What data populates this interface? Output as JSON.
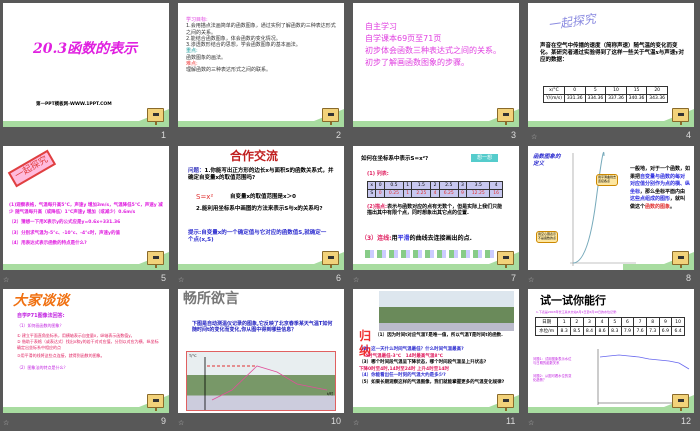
{
  "slides": [
    {
      "num": "1",
      "title": "20.3函数的表示",
      "footer": "第一PPT模板网-WWW.1PPT.COM"
    },
    {
      "num": "2",
      "goal_h": "学习目标:",
      "goals": [
        "1.会用描点法画简单的函数图象，通过实例了解函数的三种表达形式之间的关系。",
        "2.能结合函数图象，体会函数的变化情况。",
        "3.渗透数形结合的思想，学会函数图象的基本画法。"
      ],
      "key_h": "重点:",
      "key": "函数图象的画法。",
      "diff_h": "难点:",
      "diff": "理解函数的三种表达形式之间的联系。"
    },
    {
      "num": "3",
      "items": [
        "自主学习",
        "自学课本69页至71页",
        "初步体会函数三种表达式之间的关系。",
        "初步了解画函数图象的步骤。"
      ]
    },
    {
      "num": "4",
      "title": "一起探究",
      "text": "声音在空气中传播的速度（简称声速）随气温的变化而变化。某研究者通过实验得到了这样一些关于气温x与声速y对应的数据：",
      "table": {
        "row1": [
          "x/°C",
          "0",
          "5",
          "10",
          "15",
          "20"
        ],
        "row2": [
          "Y/(m/s)",
          "331.36",
          "334.36",
          "337.36",
          "340.36",
          "343.36"
        ]
      }
    },
    {
      "num": "5",
      "stamp": "一起探究",
      "q1": "(1)观察表格，气温每升高5°C，声速y 增加3m/s，气温降低5°C，声速y 减少 随气温每升高（或降低）1°C声速y 增加（或减少）0.6m/s",
      "q2": "（2）猜想一下用X表示y的公式应是y=0.6x+331.36",
      "q3": "（3）分别求气温为-5°c、-10°c、-4°c时，声速y的值",
      "q4": "（4）用表达式表示函数的特点是什么?"
    },
    {
      "num": "6",
      "title": "合作交流",
      "q_label": "问题：",
      "q1": "1.你能写出正方形的边长x与面积S的函数关系式，并确定自变量x的取值范围吗?",
      "formula": "S=x²",
      "range": "自变量x的取值范围是x＞0",
      "q2": "2.能利用坐标系中画图的方法来表示S与x的关系吗?",
      "hint": "提示:自变量x的一个确定值与它对应的函数值S,就确定一个点(x,S)"
    },
    {
      "num": "7",
      "question": "如何在坐标系中表示S=x²?",
      "badge": "想一想",
      "step1": "(1) 列表:",
      "x": [
        "x",
        "0",
        "0.5",
        "1",
        "1.5",
        "2",
        "2.5",
        "3",
        "3.5",
        "4"
      ],
      "s": [
        "S",
        "0",
        "0.25",
        "1",
        "2.25",
        "4",
        "6.25",
        "9",
        "12.25",
        "16"
      ],
      "step2_label": "(2)描点:",
      "step2": "表示与函数对应的点有无数个，但是实际上我们只能描出其中有限个点，同时想象出其它点的位置.",
      "step3_label": "（3）连线:",
      "step3_pre": "用",
      "step3_em": "平滑",
      "step3_post": "的曲线去连接画出的点."
    },
    {
      "num": "8",
      "title": "函数图象的定义",
      "callout1": "用平滑曲线去连接各点",
      "callout2": "用空心圈表示不是函数的点",
      "text_a": "一般地，对于一个函数，如果把",
      "text_b": "自变量与函数的每对对应值分别作为点的横、纵坐标",
      "text_c": "，那么坐标平面内由",
      "text_d": "这些点组成的图形",
      "text_e": "，就叫做这个",
      "text_f": "函数的图象",
      "text_g": "。"
    },
    {
      "num": "9",
      "title": "大家谈谈",
      "sub": "自学P71图像法回答:",
      "q1": "（1）如何画函数的图象？",
      "s1": "① 建立平面直角坐标系，用横轴表示自变量x，纵轴表示函数值y。",
      "s2": "② 借助于表格（或表达式）找出x和y的若干对对应值，分别以对应为横、纵坐标确定出坐标系中相应的点",
      "s3": "③用平滑的线将这些点连接，就得到函数的图象。",
      "q2": "（2）图象法的特点是什么？"
    },
    {
      "num": "10",
      "title": "畅所欲言",
      "text": "下图是自动测温仪记录的图象,它反映了北京春季某天气温T如何随时间t的变化而变化,你从图中得到哪些信息？",
      "axis_y": "T/°C",
      "axis_x": "t/时"
    },
    {
      "num": "11",
      "title": "归纳",
      "p1": "（1）因为时间t对应气温T是唯一值，所以气温T是时间t的函数.",
      "p2": "（2）这一天什么时间气温最低？什么时间气温最高?",
      "a2": "4时气温最低-3℃　14时最高气温8℃",
      "p3": "（3）哪个时间段气温呈下降状态，哪个时间段气温呈上升状态?",
      "a3": "下降0时至4时,14时至24时 上升4时至14时",
      "p4": "（4）你能看出任一时刻的气温大约是多少?",
      "p5": "（5）如果长期观察这样的气温图像，我们就能掌握更多的气温变化规律?"
    },
    {
      "num": "12",
      "title": "试一试你能行",
      "caption": "1.下表是2003年长江某水文站6月1日至6月10日的水位记录:",
      "dates": [
        "日期",
        "1",
        "2",
        "3",
        "4",
        "5",
        "6",
        "7",
        "8",
        "9",
        "10"
      ],
      "levels": [
        "水位/m",
        "8.3",
        "8.5",
        "8.4",
        "8.6",
        "8.3",
        "7.9",
        "7.6",
        "7.3",
        "6.9",
        "6.4"
      ],
      "q1": "问题1：试用图象表示水位与日期的函数关系",
      "q2": "问题2：从图可看水位的变化趋势？"
    }
  ]
}
